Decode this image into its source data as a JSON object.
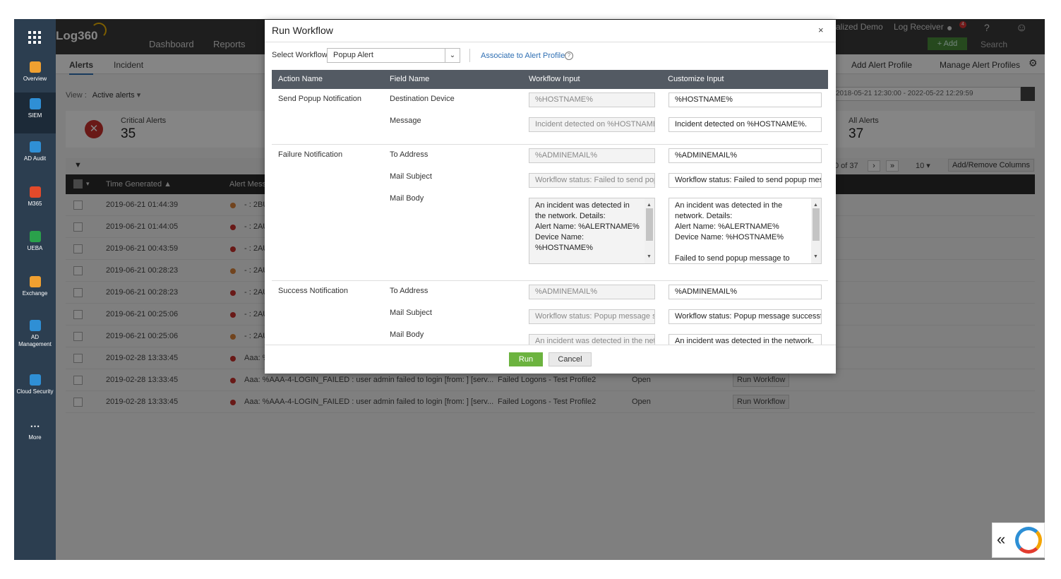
{
  "app": {
    "logo": "Log360",
    "top_tabs": [
      "Dashboard",
      "Reports"
    ],
    "top_right": {
      "demo": "alized Demo",
      "log_receiver": "Log Receiver",
      "notif_count": "4",
      "help": "?",
      "add": "+ Add",
      "search": "Search"
    }
  },
  "leftnav": [
    {
      "label": "Overview",
      "icon": "overview-icon",
      "color": "#f0a030"
    },
    {
      "label": "SIEM",
      "icon": "siem-icon",
      "color": "#2f8fd5"
    },
    {
      "label": "AD Audit",
      "icon": "ad-audit-icon",
      "color": "#2f8fd5"
    },
    {
      "label": "M365",
      "icon": "m365-icon",
      "color": "#e34a2a"
    },
    {
      "label": "UEBA",
      "icon": "ueba-icon",
      "color": "#2aa14b"
    },
    {
      "label": "Exchange",
      "icon": "exchange-icon",
      "color": "#f0a030"
    },
    {
      "label": "AD Management",
      "icon": "ad-management-icon",
      "color": "#2f8fd5"
    },
    {
      "label": "Cloud Security",
      "icon": "cloud-security-icon",
      "color": "#2f8fd5"
    },
    {
      "label": "More",
      "icon": "more-icon",
      "color": "#2c3e50"
    }
  ],
  "subtabs": [
    "Alerts",
    "Incident"
  ],
  "right_links": {
    "add_profile": "Add Alert Profile",
    "manage_profiles": "Manage Alert Profiles"
  },
  "view": {
    "label": "View :",
    "value": "Active alerts"
  },
  "date_range": "2018-05-21 12:30:00 - 2022-05-22 12:29:59",
  "stats": {
    "critical": {
      "title": "Critical Alerts",
      "value": "35"
    },
    "all": {
      "title": "All Alerts",
      "value": "37"
    }
  },
  "pager": {
    "range": "0 of 37",
    "per_page": "10",
    "columns_btn": "Add/Remove Columns"
  },
  "table": {
    "headers": {
      "time": "Time Generated",
      "msg": "Alert Mess"
    },
    "rows": [
      {
        "time": "2019-06-21 01:44:39",
        "dot": "#d9823b",
        "msg": "- : 2BU",
        "profile": "",
        "status": "",
        "action": ""
      },
      {
        "time": "2019-06-21 01:44:05",
        "dot": "#c9302c",
        "msg": "- : 2AU",
        "profile": "",
        "status": "",
        "action": ""
      },
      {
        "time": "2019-06-21 00:43:59",
        "dot": "#c9302c",
        "msg": "- : 2AU",
        "profile": "",
        "status": "",
        "action": ""
      },
      {
        "time": "2019-06-21 00:28:23",
        "dot": "#d9823b",
        "msg": "- : 2AU",
        "profile": "",
        "status": "",
        "action": ""
      },
      {
        "time": "2019-06-21 00:28:23",
        "dot": "#c9302c",
        "msg": "- : 2AU",
        "profile": "",
        "status": "",
        "action": ""
      },
      {
        "time": "2019-06-21 00:25:06",
        "dot": "#c9302c",
        "msg": "- : 2AU",
        "profile": "",
        "status": "",
        "action": ""
      },
      {
        "time": "2019-06-21 00:25:06",
        "dot": "#d9823b",
        "msg": "- : 2AU",
        "profile": "",
        "status": "",
        "action": ""
      },
      {
        "time": "2019-02-28 13:33:45",
        "dot": "#c9302c",
        "msg": "Aaa: %",
        "profile": "",
        "status": "",
        "action": ""
      },
      {
        "time": "2019-02-28 13:33:45",
        "dot": "#c9302c",
        "msg": "Aaa: %AAA-4-LOGIN_FAILED : user admin failed to login [from: ] [serv...",
        "profile": "Failed Logons - Test Profile2",
        "status": "Open",
        "action": "Run Workflow"
      },
      {
        "time": "2019-02-28 13:33:45",
        "dot": "#c9302c",
        "msg": "Aaa: %AAA-4-LOGIN_FAILED : user admin failed to login [from: ] [serv...",
        "profile": "Failed Logons - Test Profile2",
        "status": "Open",
        "action": "Run Workflow"
      }
    ]
  },
  "modal": {
    "title": "Run Workflow",
    "close": "×",
    "select_label": "Select Workflow",
    "select_value": "Popup Alert",
    "associate_link": "Associate to Alert Profile",
    "help": "?",
    "headers": [
      "Action Name",
      "Field Name",
      "Workflow Input",
      "Customize Input"
    ],
    "sections": [
      {
        "action": "Send Popup Notification",
        "fields": [
          {
            "name": "Destination Device",
            "wf": "%HOSTNAME%",
            "cu": "%HOSTNAME%"
          },
          {
            "name": "Message",
            "wf": "Incident detected on %HOSTNAME%.",
            "cu": "Incident detected on %HOSTNAME%."
          }
        ]
      },
      {
        "action": "Failure Notification",
        "fields": [
          {
            "name": "To Address",
            "wf": "%ADMINEMAIL%",
            "cu": "%ADMINEMAIL%"
          },
          {
            "name": "Mail Subject",
            "wf": "Workflow status: Failed to send popup message",
            "cu": "Workflow status: Failed to send popup message"
          },
          {
            "name": "Mail Body",
            "wf_lines": [
              "An incident was detected in the network. Details:",
              "Alert Name: %ALERTNAME%",
              "Device Name: %HOSTNAME%"
            ],
            "cu_lines": [
              "An incident was detected in the network. Details:",
              "Alert Name: %ALERTNAME%",
              "Device Name: %HOSTNAME%",
              "",
              "Failed to send popup message to"
            ]
          }
        ]
      },
      {
        "action": "Success Notification",
        "fields": [
          {
            "name": "To Address",
            "wf": "%ADMINEMAIL%",
            "cu": "%ADMINEMAIL%"
          },
          {
            "name": "Mail Subject",
            "wf": "Workflow status: Popup message sent successfully",
            "cu": "Workflow status: Popup message successfully sent"
          },
          {
            "name": "Mail Body",
            "wf": "An incident was detected in the network.",
            "cu": "An incident was detected in the network."
          }
        ]
      }
    ],
    "run": "Run",
    "cancel": "Cancel"
  },
  "chat": {
    "arrows": "«"
  }
}
